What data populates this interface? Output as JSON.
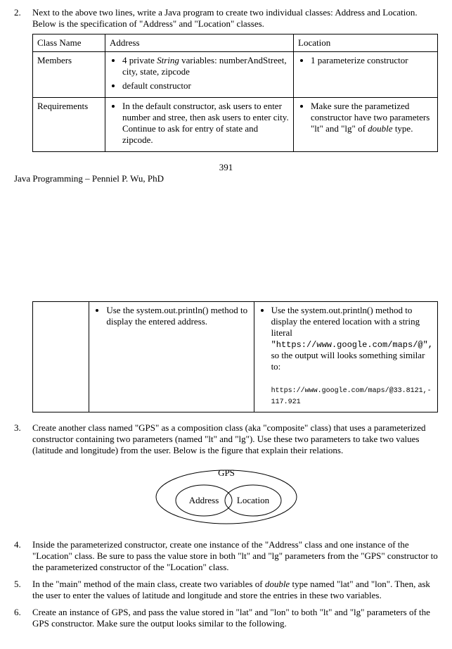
{
  "q2": {
    "num": "2.",
    "intro_l1": "Next to the above two lines, write a Java program to create two individual classes: Address and Location.",
    "intro_l2": "Below is the specification of \"Address\" and \"Location\" classes.",
    "table1": {
      "r1c1": "Class Name",
      "r1c2": "Address",
      "r1c3": "Location",
      "r2c1": "Members",
      "addr_b1a": "4 private ",
      "addr_b1b": "String",
      "addr_b1c": " variables: numberAndStreet, city, state, zipcode",
      "addr_b2": "default constructor",
      "loc_b1": "1 parameterize constructor",
      "r3c1": "Requirements",
      "req_addr": "In the default constructor, ask users to enter number and stree, then ask users to enter city. Continue to ask for entry of state and zipcode.",
      "req_loc_a": "Make sure the parametized constructor have two parameters \"lt\" and \"lg\" of ",
      "req_loc_b": "double",
      "req_loc_c": " type."
    },
    "page_num": "391",
    "footer": "Java Programming – Penniel P. Wu, PhD",
    "table2": {
      "left_b1": "Use the system.out.println() method to display the entered address.",
      "right_b1": "Use the system.out.println() method to display the entered location with a string literal",
      "right_url": "\"https://www.google.com/maps/@\",",
      "right_b1b": "so the output will looks something similar to:",
      "right_ex": "https://www.google.com/maps/@33.8121,-117.921"
    }
  },
  "q3": {
    "num": "3.",
    "text": "Create another class named \"GPS\" as a composition class (aka \"composite\" class) that uses a parameterized constructor containing two parameters (named \"lt\" and \"lg\"). Use these two parameters to take two values (latitude and longitude) from the user. Below is the figure that explain their relations.",
    "venn": {
      "outer": "GPS",
      "left": "Address",
      "right": "Location"
    }
  },
  "q4": {
    "num": "4.",
    "text": "Inside the parameterized constructor, create one instance of the \"Address\" class and one instance of the \"Location\" class. Be sure to pass the value store in both \"lt\" and \"lg\" parameters from the \"GPS\" constructor to the parameterized constructor of the \"Location\" class."
  },
  "q5": {
    "num": "5.",
    "t1": "In the \"main\" method of the main class, create two variables of ",
    "t2": "double",
    "t3": " type named \"lat\" and \"lon\". Then, ask the user to enter the values of latitude and longitude and store the entries in these two variables."
  },
  "q6": {
    "num": "6.",
    "text": "Create an instance of GPS, and pass the value stored in \"lat\" and \"lon\" to both \"lt\" and \"lg\" parameters of the GPS constructor. Make sure the output looks similar to the following."
  }
}
